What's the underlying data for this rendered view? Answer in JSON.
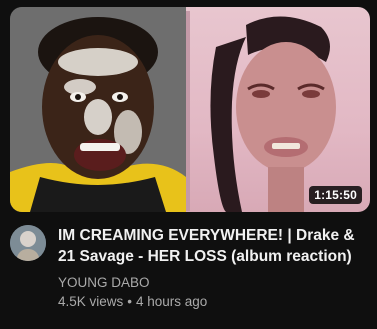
{
  "video": {
    "title": "IM CREAMING EVERYWHERE! | Drake & 21 Savage - HER LOSS (album reaction)",
    "duration": "1:15:50",
    "channel": "YOUNG DABO",
    "views": "4.5K views",
    "separator": "•",
    "age": "4 hours ago"
  },
  "colors": {
    "background": "#0f0f0f",
    "title_text": "#f1f1f1",
    "secondary_text": "#aaaaaa"
  }
}
